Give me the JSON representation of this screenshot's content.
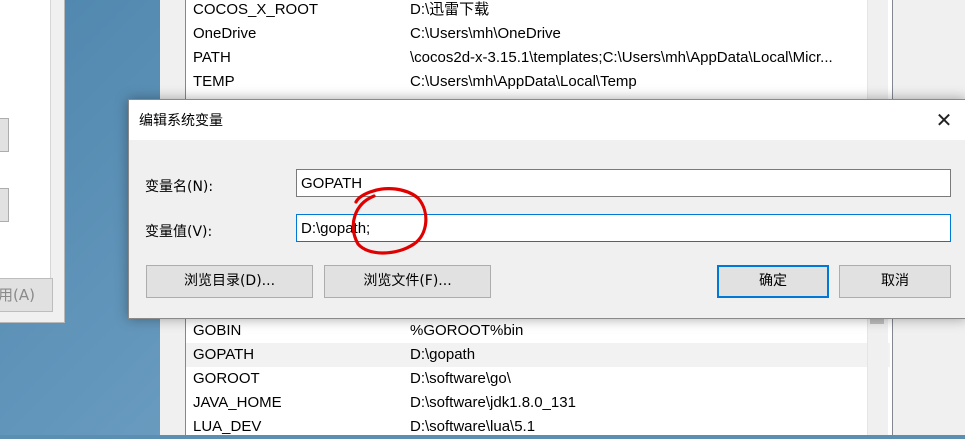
{
  "env_list": {
    "top_rows": [
      {
        "name": "COCOS_X_ROOT",
        "value": "D:\\迅雷下载"
      },
      {
        "name": "OneDrive",
        "value": "C:\\Users\\mh\\OneDrive"
      },
      {
        "name": "PATH",
        "value": "\\cocos2d-x-3.15.1\\templates;C:\\Users\\mh\\AppData\\Local\\Micr..."
      },
      {
        "name": "TEMP",
        "value": "C:\\Users\\mh\\AppData\\Local\\Temp"
      }
    ],
    "bottom_rows": [
      {
        "name": "GOBIN",
        "value": "%GOROOT%bin"
      },
      {
        "name": "GOPATH",
        "value": "D:\\gopath"
      },
      {
        "name": "GOROOT",
        "value": "D:\\software\\go\\"
      },
      {
        "name": "JAVA_HOME",
        "value": "D:\\software\\jdk1.8.0_131"
      },
      {
        "name": "LUA_DEV",
        "value": "D:\\software\\lua\\5.1"
      }
    ]
  },
  "left_window": {
    "button_label": "用(A)"
  },
  "dialog": {
    "title": "编辑系统变量",
    "close_label": "✕",
    "var_name_label": "变量名(N):",
    "var_name_value": "GOPATH",
    "var_value_label": "变量值(V):",
    "var_value_value": "D:\\gopath;",
    "browse_dir_label": "浏览目录(D)...",
    "browse_file_label": "浏览文件(F)...",
    "ok_label": "确定",
    "cancel_label": "取消"
  },
  "colors": {
    "accent": "#0078d7",
    "annotation": "#e00000"
  }
}
